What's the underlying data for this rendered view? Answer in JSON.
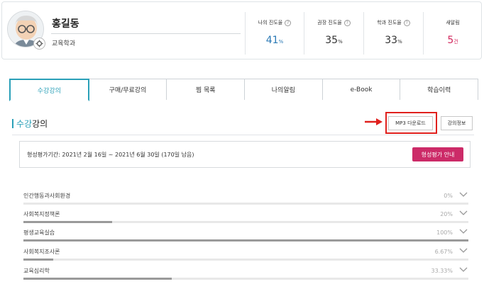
{
  "profile": {
    "name": "홍길동",
    "department": "교육학과",
    "stats": [
      {
        "title": "나의 진도율",
        "value": "41",
        "unit": "%",
        "color": "#2a79b5"
      },
      {
        "title": "권장 진도율",
        "value": "35",
        "unit": "%",
        "color": "#333333"
      },
      {
        "title": "학과 진도율",
        "value": "33",
        "unit": "%",
        "color": "#333333"
      },
      {
        "title": "새알림",
        "value": "5",
        "unit": "건",
        "color": "#d2285e"
      }
    ]
  },
  "tabs": [
    {
      "label": "수강강의",
      "active": true
    },
    {
      "label": "구매/무료강의",
      "active": false
    },
    {
      "label": "찜 목록",
      "active": false
    },
    {
      "label": "나의알림",
      "active": false
    },
    {
      "label": "e-Book",
      "active": false
    },
    {
      "label": "학습이력",
      "active": false
    }
  ],
  "section": {
    "title_highlight": "수강",
    "title_rest": "강의",
    "mp3_label": "MP3 다운로드",
    "info_label": "강의정보"
  },
  "eval": {
    "text": "형성평가기간: 2021년 2월 16일 ~ 2021년 6월 30일 (170일 남음)",
    "button": "형성평가 안내"
  },
  "courses": [
    {
      "name": "인간행동과사회환경",
      "progress": "0%",
      "fraction": 0.0
    },
    {
      "name": "사회복지정책론",
      "progress": "20%",
      "fraction": 0.2
    },
    {
      "name": "평생교육실습",
      "progress": "100%",
      "fraction": 1.0
    },
    {
      "name": "사회복지조사론",
      "progress": "6.67%",
      "fraction": 0.0667
    },
    {
      "name": "교육심리학",
      "progress": "33.33%",
      "fraction": 0.3333
    }
  ],
  "colors": {
    "accent": "#2aa0b8",
    "highlight_box": "#e0201d",
    "eval_button": "#cc2b68"
  },
  "icons": [
    "gear-icon",
    "question-icon",
    "chevron-down-icon",
    "arrow-right-icon"
  ]
}
